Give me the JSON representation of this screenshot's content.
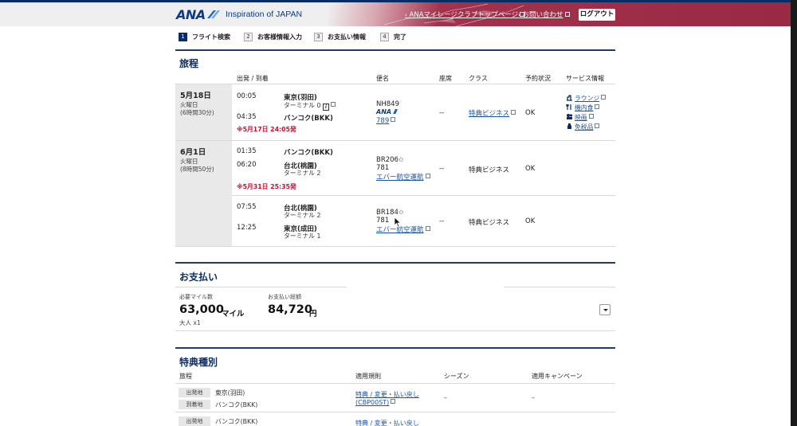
{
  "header": {
    "logo": "ANA",
    "tagline": "Inspiration of JAPAN",
    "links": [
      {
        "label": "ANAマイレージクラブトップページ"
      },
      {
        "label": "お問い合わせ"
      }
    ],
    "logout": "ログアウト",
    "colors": {
      "navy": "#0a2c64",
      "red": "#9a2a44"
    }
  },
  "steps": [
    {
      "num": "1",
      "label": "フライト検索"
    },
    {
      "num": "2",
      "label": "お客様情報入力"
    },
    {
      "num": "3",
      "label": "お支払い情報"
    },
    {
      "num": "4",
      "label": "完了"
    }
  ],
  "itinerary": {
    "title": "旅程",
    "columns": {
      "route": "出発 / 到着",
      "flight": "便名",
      "seat": "座席",
      "class": "クラス",
      "status": "予約状況",
      "service": "サービス情報"
    },
    "groups": [
      {
        "date": "5月18日",
        "weekday": "火曜日",
        "duration": "(6時間30分)",
        "segments": [
          {
            "dep_time": "00:05",
            "dep_place": "東京(羽田)",
            "dep_terminal": "ターミナル 0",
            "arr_time": "04:35",
            "arr_place": "バンコク(BKK)",
            "arr_terminal": "",
            "note": "※5月17日 24:05発",
            "flight_no": "NH849",
            "carrier": "ANA",
            "aircraft": "789",
            "seat": "--",
            "class": "特典ビジネス",
            "status": "OK",
            "services": [
              "ラウンジ",
              "機内食",
              "映画",
              "免税品"
            ]
          }
        ]
      },
      {
        "date": "6月1日",
        "weekday": "火曜日",
        "duration": "(8時間50分)",
        "segments": [
          {
            "dep_time": "01:35",
            "dep_place": "バンコク(BKK)",
            "dep_terminal": "",
            "arr_time": "06:20",
            "arr_place": "台北(桃園)",
            "arr_terminal": "ターミナル 2",
            "note": "※5月31日 25:35発",
            "flight_no": "BR206",
            "aircraft": "781",
            "operator": "エバー航空運航",
            "seat": "--",
            "class": "特典ビジネス",
            "status": "OK"
          },
          {
            "dep_time": "07:55",
            "dep_place": "台北(桃園)",
            "dep_terminal": "ターミナル 2",
            "arr_time": "12:25",
            "arr_place": "東京(成田)",
            "arr_terminal": "ターミナル 1",
            "flight_no": "BR184",
            "aircraft": "781",
            "operator": "エバー航空運航",
            "seat": "--",
            "class": "特典ビジネス",
            "status": "OK"
          }
        ]
      }
    ]
  },
  "payment": {
    "title": "お支払い",
    "miles_label": "必要マイル数",
    "miles_value": "63,000",
    "miles_unit": "マイル",
    "passengers": "大人 x1",
    "total_label": "お支払い総額",
    "total_value": "84,720",
    "total_unit": "円"
  },
  "award": {
    "title": "特典種別",
    "columns": {
      "route": "旅程",
      "rule": "適用規則",
      "season": "シーズン",
      "campaign": "適用キャンペーン"
    },
    "rows": [
      {
        "dep_tag": "出発地",
        "dep": "東京(羽田)",
        "arr_tag": "到着地",
        "arr": "バンコク(BKK)",
        "rule_line1": "特典 / 変更・払い戻し",
        "rule_line2": "(CBP00ST)",
        "season": "–",
        "campaign": "–"
      },
      {
        "dep_tag": "出発地",
        "dep": "バンコク(BKK)",
        "rule_line1": "特典 / 変更・払い戻し"
      }
    ]
  }
}
